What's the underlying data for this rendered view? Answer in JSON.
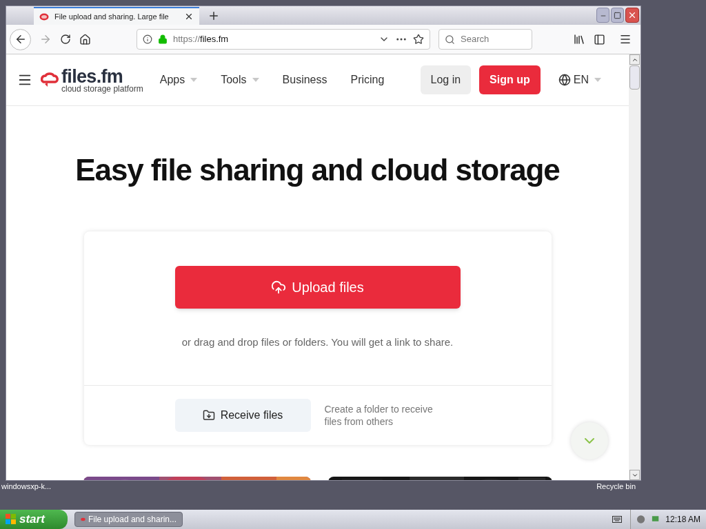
{
  "browser": {
    "tab_title": "File upload and sharing. Large file",
    "url_scheme": "https://",
    "url_host": "files.fm",
    "search": {
      "placeholder": "Search"
    }
  },
  "site_header": {
    "logo": "files.fm",
    "tagline": "cloud storage platform",
    "nav": [
      {
        "label": "Apps",
        "kind": "dropdown"
      },
      {
        "label": "Tools",
        "kind": "dropdown"
      },
      {
        "label": "Business",
        "kind": "link"
      },
      {
        "label": "Pricing",
        "kind": "link"
      }
    ],
    "login": "Log in",
    "signup": "Sign up",
    "language": "EN"
  },
  "hero": {
    "heading": "Easy file sharing and cloud storage",
    "upload_button": "Upload files",
    "drop_hint": "or drag and drop files or folders. You will get a link to share.",
    "receive_button": "Receive files",
    "receive_hint": "Create a folder to receive files from others"
  },
  "desktop_icons": [
    "windowsxp-k...",
    "Recycle bin"
  ],
  "taskbar": {
    "start": "start",
    "task": "File upload and sharin...",
    "clock": "12:18 AM"
  }
}
